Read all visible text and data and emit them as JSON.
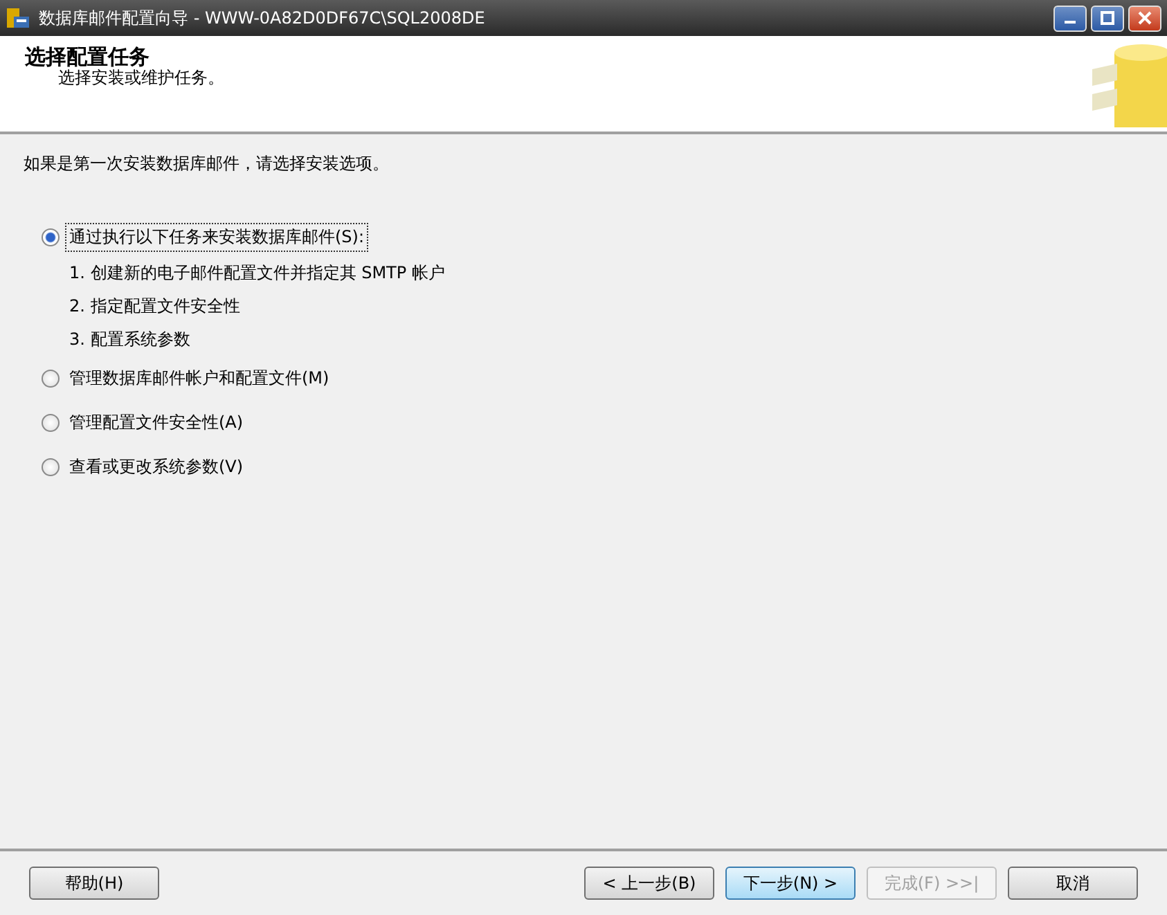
{
  "window": {
    "title": "数据库邮件配置向导 - WWW-0A82D0DF67C\\SQL2008DE"
  },
  "header": {
    "title": "选择配置任务",
    "subtitle": "选择安装或维护任务。"
  },
  "intro": "如果是第一次安装数据库邮件，请选择安装选项。",
  "options": [
    {
      "label": "通过执行以下任务来安装数据库邮件(S):",
      "selected": true,
      "steps": [
        "1. 创建新的电子邮件配置文件并指定其 SMTP 帐户",
        "2. 指定配置文件安全性",
        "3. 配置系统参数"
      ]
    },
    {
      "label": "管理数据库邮件帐户和配置文件(M)",
      "selected": false
    },
    {
      "label": "管理配置文件安全性(A)",
      "selected": false
    },
    {
      "label": "查看或更改系统参数(V)",
      "selected": false
    }
  ],
  "buttons": [
    {
      "label": "帮助(H)",
      "disabled": false,
      "focused": false
    },
    {
      "label": "< 上一步(B)",
      "disabled": false,
      "focused": false
    },
    {
      "label": "下一步(N) >",
      "disabled": false,
      "focused": true
    },
    {
      "label": "完成(F) >>|",
      "disabled": true,
      "focused": false
    },
    {
      "label": "取消",
      "disabled": false,
      "focused": false
    }
  ]
}
